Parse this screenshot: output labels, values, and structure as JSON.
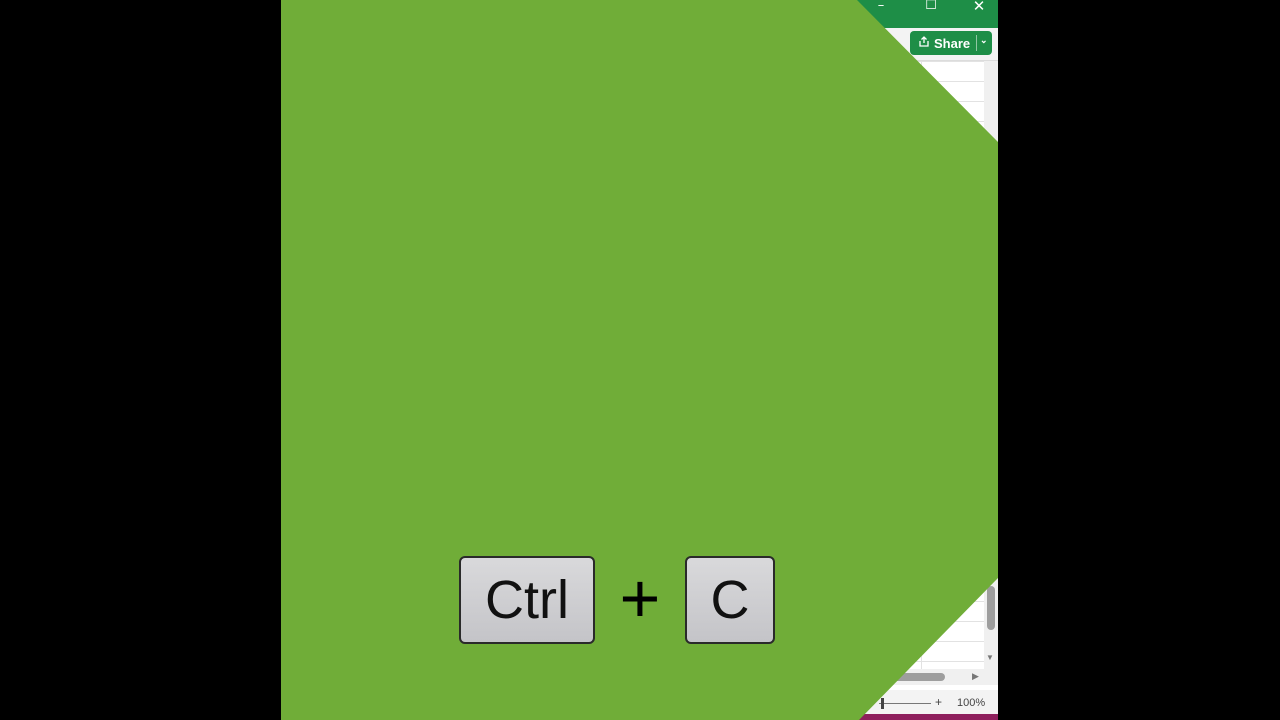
{
  "window": {
    "minimize_glyph": "–",
    "maximize_glyph": "☐",
    "close_glyph": "✕"
  },
  "ribbon": {
    "share_label": "Share",
    "share_caret": "⌄"
  },
  "scrollbars": {
    "down_arrow": "▼",
    "right_arrow": "▶"
  },
  "statusbar": {
    "zoom_plus": "+",
    "zoom_level": "100%"
  },
  "shortcut": {
    "key_1": "Ctrl",
    "joiner": "+",
    "key_2": "C"
  },
  "colors": {
    "overlay_green": "#70ad38",
    "excel_green": "#1e8e47",
    "accent_magenta": "#8e1f5c",
    "key_face": "#cfcfd2"
  }
}
